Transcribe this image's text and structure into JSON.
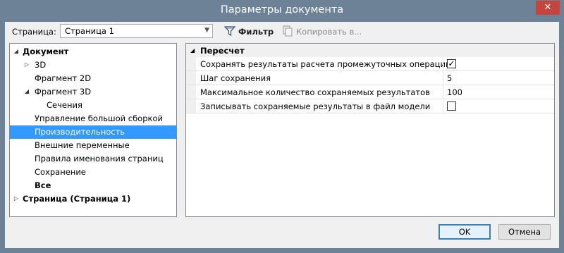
{
  "window": {
    "title": "Параметры документа",
    "close_glyph": "✕"
  },
  "toolbar": {
    "page_label": "Страница:",
    "page_select_value": "Страница 1",
    "filter_label": "Фильтр",
    "copy_label": "Копировать в..."
  },
  "tree": {
    "items": [
      {
        "label": "Документ",
        "expander": "◢"
      },
      {
        "label": "3D",
        "expander": "▷"
      },
      {
        "label": "Фрагмент 2D"
      },
      {
        "label": "Фрагмент 3D",
        "expander": "◢"
      },
      {
        "label": "Сечения"
      },
      {
        "label": "Управление большой сборкой"
      },
      {
        "label": "Производительность",
        "selected": true
      },
      {
        "label": "Внешние переменные"
      },
      {
        "label": "Правила именования страниц"
      },
      {
        "label": "Сохранение"
      },
      {
        "label": "Все"
      },
      {
        "label": "Страница (Страница 1)",
        "expander": "▷"
      }
    ]
  },
  "grid": {
    "group_expander": "◢",
    "group_title": "Пересчет",
    "rows": [
      {
        "name": "Сохранять результаты расчета промежуточных операций",
        "type": "checkbox",
        "checked": true,
        "check_glyph": "✓"
      },
      {
        "name": "Шаг сохранения",
        "type": "text",
        "value": "5"
      },
      {
        "name": "Максимальное количество сохраняемых результатов",
        "type": "text",
        "value": "100"
      },
      {
        "name": "Записывать сохраняемые результаты в файл модели",
        "type": "checkbox",
        "checked": false,
        "check_glyph": ""
      }
    ]
  },
  "buttons": {
    "ok": "OK",
    "cancel": "Отмена"
  },
  "colors": {
    "selection": "#3399ff",
    "titlebar": "#6d8296",
    "close": "#c4443e"
  }
}
